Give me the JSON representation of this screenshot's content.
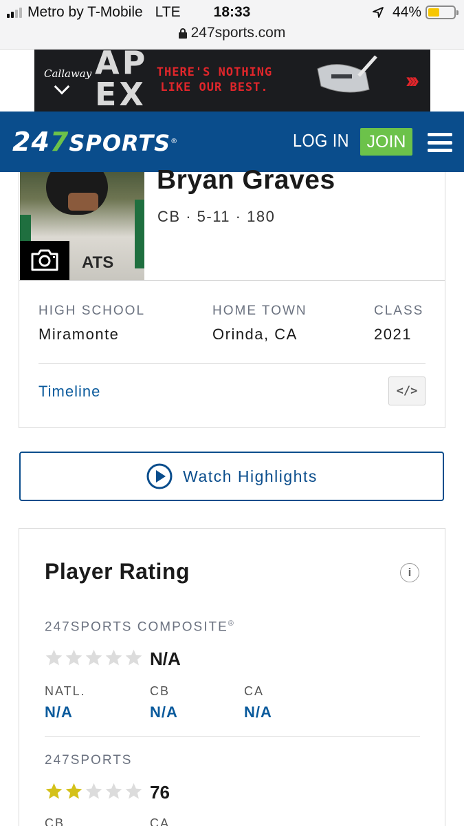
{
  "status_bar": {
    "carrier": "Metro by T-Mobile",
    "network": "LTE",
    "time": "18:33",
    "battery_percent": "44%",
    "battery_level": 0.44,
    "signal_bars": 2
  },
  "browser": {
    "url": "247sports.com"
  },
  "ad": {
    "brand": "Callaway",
    "headline": "AP EX",
    "tagline": "THERE'S NOTHING LIKE OUR BEST."
  },
  "header": {
    "logo_247": "247",
    "logo_sports": "SPORTS",
    "login_label": "LOG IN",
    "join_label": "JOIN",
    "colors": {
      "bar": "#0a4d8c",
      "accent": "#6cc24a"
    }
  },
  "profile": {
    "name": "Bryan Graves",
    "position": "CB",
    "height": "5-11",
    "weight": "180",
    "meta_sep": "·",
    "jersey_text": "ATS",
    "high_school_label": "HIGH SCHOOL",
    "high_school": "Miramonte",
    "home_town_label": "HOME TOWN",
    "home_town": "Orinda, CA",
    "class_label": "CLASS",
    "class": "2021",
    "timeline_label": "Timeline",
    "embed_label": "</>"
  },
  "watch": {
    "label": "Watch Highlights"
  },
  "rating": {
    "title": "Player Rating",
    "info_icon": "i",
    "composite": {
      "label": "247SPORTS COMPOSITE",
      "mark": "®",
      "stars": 0,
      "score": "N/A",
      "ranks": [
        {
          "label": "NATL.",
          "value": "N/A"
        },
        {
          "label": "CB",
          "value": "N/A"
        },
        {
          "label": "CA",
          "value": "N/A"
        }
      ]
    },
    "sports247": {
      "label": "247SPORTS",
      "stars": 2,
      "score": "76",
      "ranks": [
        {
          "label": "CB"
        },
        {
          "label": "CA"
        }
      ]
    },
    "colors": {
      "star_on": "#d4c11a",
      "star_off": "#dcdcdc",
      "link": "#0a5a9c"
    }
  }
}
